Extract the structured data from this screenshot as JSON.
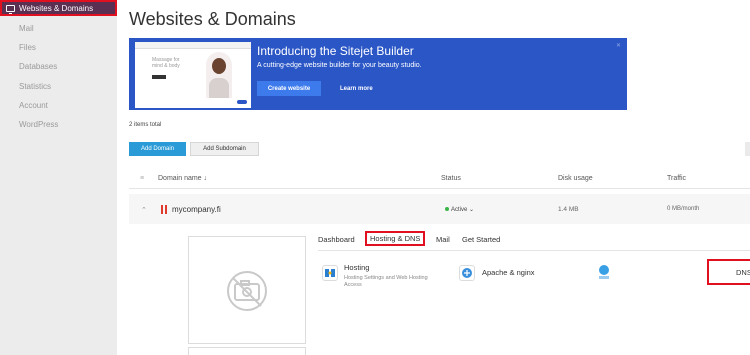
{
  "sidebar": {
    "items": [
      {
        "label": "Websites & Domains",
        "icon": "monitor-icon",
        "active": true
      },
      {
        "label": "Mail",
        "icon": "mail-icon"
      },
      {
        "label": "Files",
        "icon": "folder-icon"
      },
      {
        "label": "Databases",
        "icon": "database-icon"
      },
      {
        "label": "Statistics",
        "icon": "chart-icon"
      },
      {
        "label": "Account",
        "icon": "user-icon"
      },
      {
        "label": "WordPress",
        "icon": "wordpress-icon"
      }
    ],
    "collapse_glyph": "‹"
  },
  "main": {
    "title": "Websites & Domains",
    "banner": {
      "title": "Introducing the Sitejet Builder",
      "subtitle": "A cutting-edge website builder for your beauty studio.",
      "create_label": "Create website",
      "learn_label": "Learn more",
      "close_glyph": "✕",
      "thumb_text": "Massage for mind & body"
    },
    "items_total": "2 items total",
    "add_domain_label": "Add Domain",
    "add_subdomain_label": "Add Subdomain",
    "table": {
      "select_glyph": "≡",
      "col_domain": "Domain name ↓",
      "col_status": "Status",
      "col_disk": "Disk usage",
      "col_traffic": "Traffic"
    },
    "domain_row": {
      "expand_glyph": "⌃",
      "name": "mycompany.fi",
      "status": "Active ⌄",
      "disk": "1.4 MB",
      "traffic": "0 MB/month"
    },
    "tabs": [
      "Dashboard",
      "Hosting & DNS",
      "Mail",
      "Get Started"
    ],
    "tiles": {
      "hosting_title": "Hosting",
      "hosting_desc": "Hosting Settings and Web Hosting Access",
      "apache_label": "Apache & nginx",
      "dns_label": "DNS"
    }
  },
  "colors": {
    "sidebar_active": "#5b2f52",
    "banner_blue": "#2a56c6",
    "primary_button": "#2a9bd6",
    "highlight_red": "#e01020",
    "status_green": "#3bb44a"
  }
}
